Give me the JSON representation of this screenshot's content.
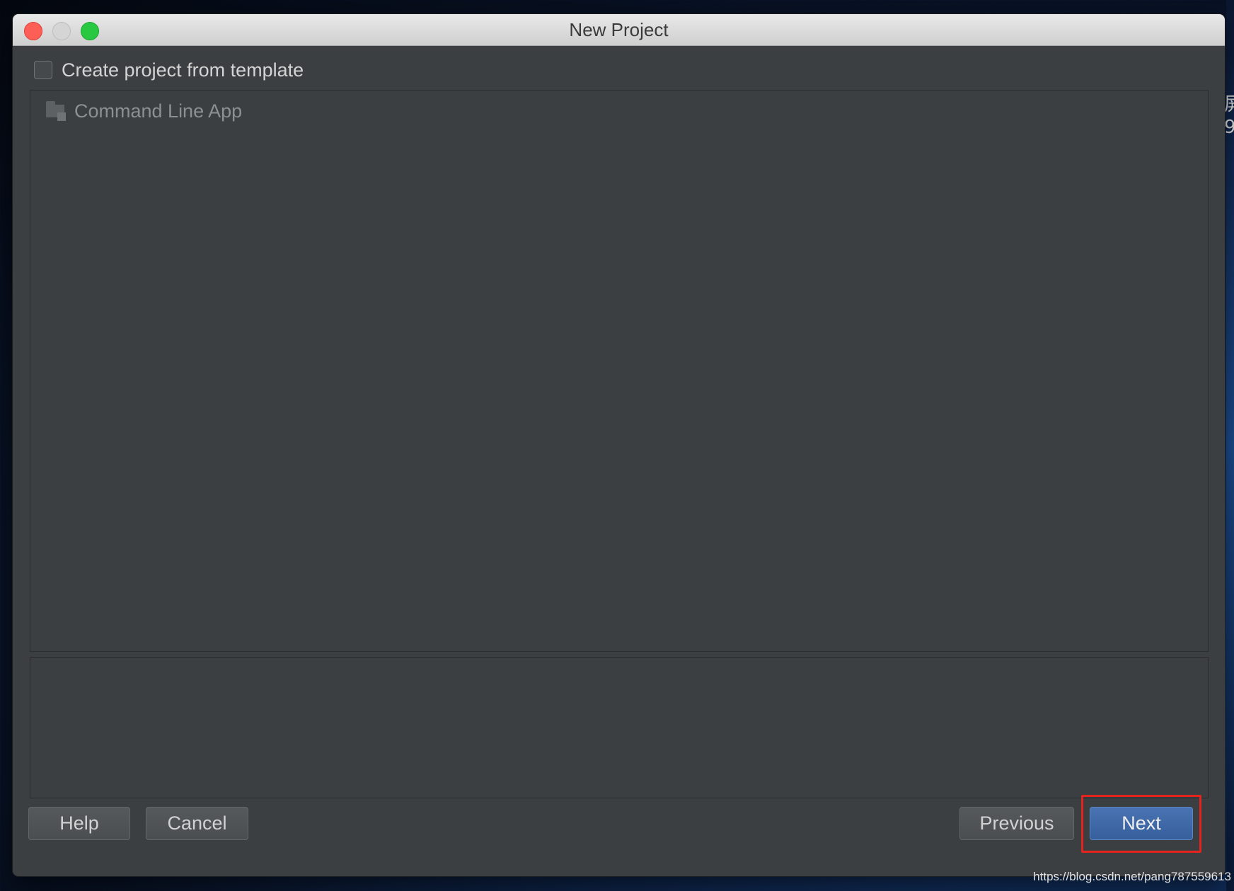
{
  "window": {
    "title": "New Project"
  },
  "template_option": {
    "label": "Create project from template",
    "checked": false
  },
  "templates": [
    {
      "label": "Command Line App",
      "icon": "folder-icon"
    }
  ],
  "buttons": {
    "help": "Help",
    "cancel": "Cancel",
    "previous": "Previous",
    "next": "Next"
  },
  "desktop": {
    "side_glyphs": "屏\n9"
  },
  "watermark": "https://blog.csdn.net/pang787559613",
  "colors": {
    "dialog_background": "#3b3f42",
    "primary_button": "#365f9c",
    "highlight_box": "#e3231d",
    "traffic_close": "#fd5f57",
    "traffic_zoom": "#28c940"
  }
}
